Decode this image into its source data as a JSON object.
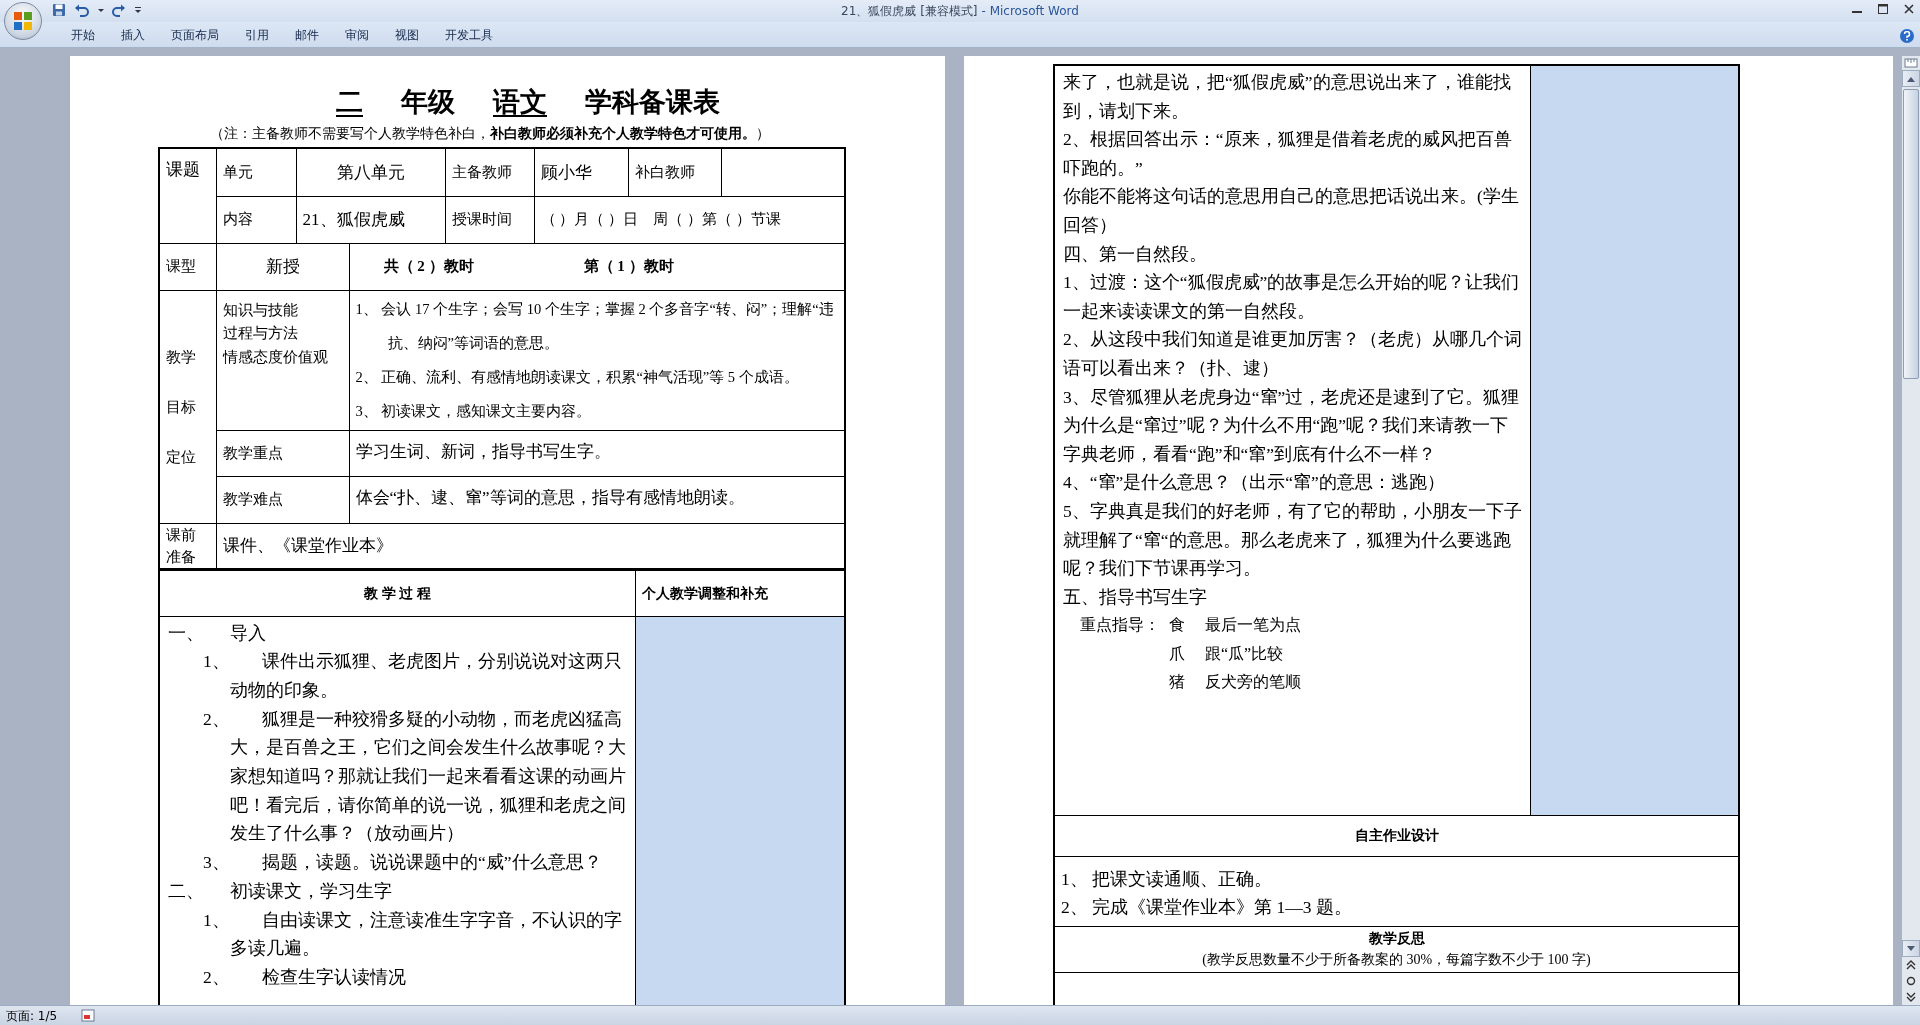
{
  "window": {
    "document": "21、狐假虎威 [兼容模式]",
    "app": "- Microsoft Word"
  },
  "ribbon_tabs": [
    "开始",
    "插入",
    "页面布局",
    "引用",
    "邮件",
    "审阅",
    "视图",
    "开发工具"
  ],
  "left_page": {
    "title": [
      {
        "kind": "blank",
        "text": "二"
      },
      {
        "kind": "text",
        "text": "年级"
      },
      {
        "kind": "blank",
        "text": "语文"
      },
      {
        "kind": "text",
        "text": "学科备课表"
      }
    ],
    "note": "（注：主备教师不需要写个人教学特色补白，**补白教师必须补充个人教学特色才可使用。**）",
    "plan_table": {
      "topic_label": "课题",
      "unit_label": "单元",
      "unit": "第八单元",
      "lead_teacher_label": "主备教师",
      "lead_teacher": "顾小华",
      "supplement_teacher_label": "补白教师",
      "content_label": "内容",
      "content": "21、狐假虎威",
      "time_label": "授课时间",
      "time": "（ ）月（ ）日　周（ ）第（ ）节课",
      "type_label": "课型",
      "type": "新授",
      "periods": [
        "共（ 2 ）教时",
        "第（ 1 ）教时"
      ],
      "goal_label": [
        "教学",
        "目标",
        "定位"
      ],
      "goal_dimensions": [
        "知识与技能",
        "过程与方法",
        "情感态度价值观"
      ],
      "goals": [
        "1、 会认 17 个生字；会写 10 个生字；掌握 2 个多音字“转、闷”；理解“违抗、纳闷”等词语的意思。",
        "2、 正确、流利、有感情地朗读课文，积累“神气活现”等 5 个成语。",
        "3、 初读课文，感知课文主要内容。"
      ],
      "key_points_label": "教学重点",
      "key_points": "学习生词、新词，指导书写生字。",
      "difficulties_label": "教学难点",
      "difficulties": "体会“扑、逮、窜”等词的意思，指导有感情地朗读。",
      "preparation_label": [
        "课前",
        "准备"
      ],
      "preparation": "课件、《课堂作业本》"
    },
    "process": {
      "header": "教 学 过 程",
      "side_header": "个人教学调整和补充",
      "steps": [
        {
          "number": "一、",
          "text": "导入",
          "children": [
            {
              "number": "1、",
              "text": "课件出示狐狸、老虎图片，分别说说对这两只动物的印象。"
            },
            {
              "number": "2、",
              "text": "狐狸是一种狡猾多疑的小动物，而老虎凶猛高大，是百兽之王，它们之间会发生什么故事呢？大家想知道吗？那就让我们一起来看看这课的动画片吧！看完后，请你简单的说一说，狐狸和老虎之间发生了什么事？（放动画片）"
            },
            {
              "number": "3、",
              "text": "揭题，读题。说说课题中的“威”什么意思？"
            }
          ]
        },
        {
          "number": "二、",
          "text": "初读课文，学习生字",
          "children": [
            {
              "number": "1、",
              "text": "自由读课文，注意读准生字字音，不认识的字多读几遍。"
            },
            {
              "number": "2、",
              "text": "检查生字认读情况"
            }
          ]
        }
      ]
    }
  },
  "right_page": {
    "process_lines": [
      "来了，也就是说，把“狐假虎威”的意思说出来了，谁能找到，请划下来。",
      "2、根据回答出示：“原来，狐狸是借着老虎的威风把百兽吓跑的。”",
      "你能不能将这句话的意思用自己的意思把话说出来。(学生回答）",
      "四、第一自然段。",
      "1、过渡：这个“狐假虎威”的故事是怎么开始的呢？让我们一起来读读课文的第一自然段。",
      "2、从这段中我们知道是谁更加厉害？（老虎）从哪几个词语可以看出来？（扑、逮）",
      "3、尽管狐狸从老虎身边“窜”过，老虎还是逮到了它。狐狸为什么是“窜过”呢？为什么不用“跑”呢？我们来请教一下字典老师，看看“跑”和“窜”到底有什么不一样？",
      "4、“窜”是什么意思？（出示“窜”的意思：逃跑）",
      "5、字典真是我们的好老师，有了它的帮助，小朋友一下子就理解了“窜“的意思。那么老虎来了，狐狸为什么要逃跑呢？我们下节课再学习。",
      "五、指导书写生字"
    ],
    "guide": {
      "label": "重点指导：",
      "items": [
        {
          "char": "食",
          "note": "最后一笔为点"
        },
        {
          "char": "爪",
          "note": "跟“瓜”比较"
        },
        {
          "char": "猪",
          "note": "反犬旁的笔顺"
        }
      ]
    },
    "homework": {
      "header": "自主作业设计",
      "items": [
        "1、 把课文读通顺、正确。",
        "2、 完成《课堂作业本》第 1—3 题。"
      ]
    },
    "reflection": {
      "title": "教学反思",
      "note": "(教学反思数量不少于所备教案的 30%，每篇字数不少于 100 字)"
    }
  },
  "status_bar": {
    "page": "页面: 1/5"
  }
}
